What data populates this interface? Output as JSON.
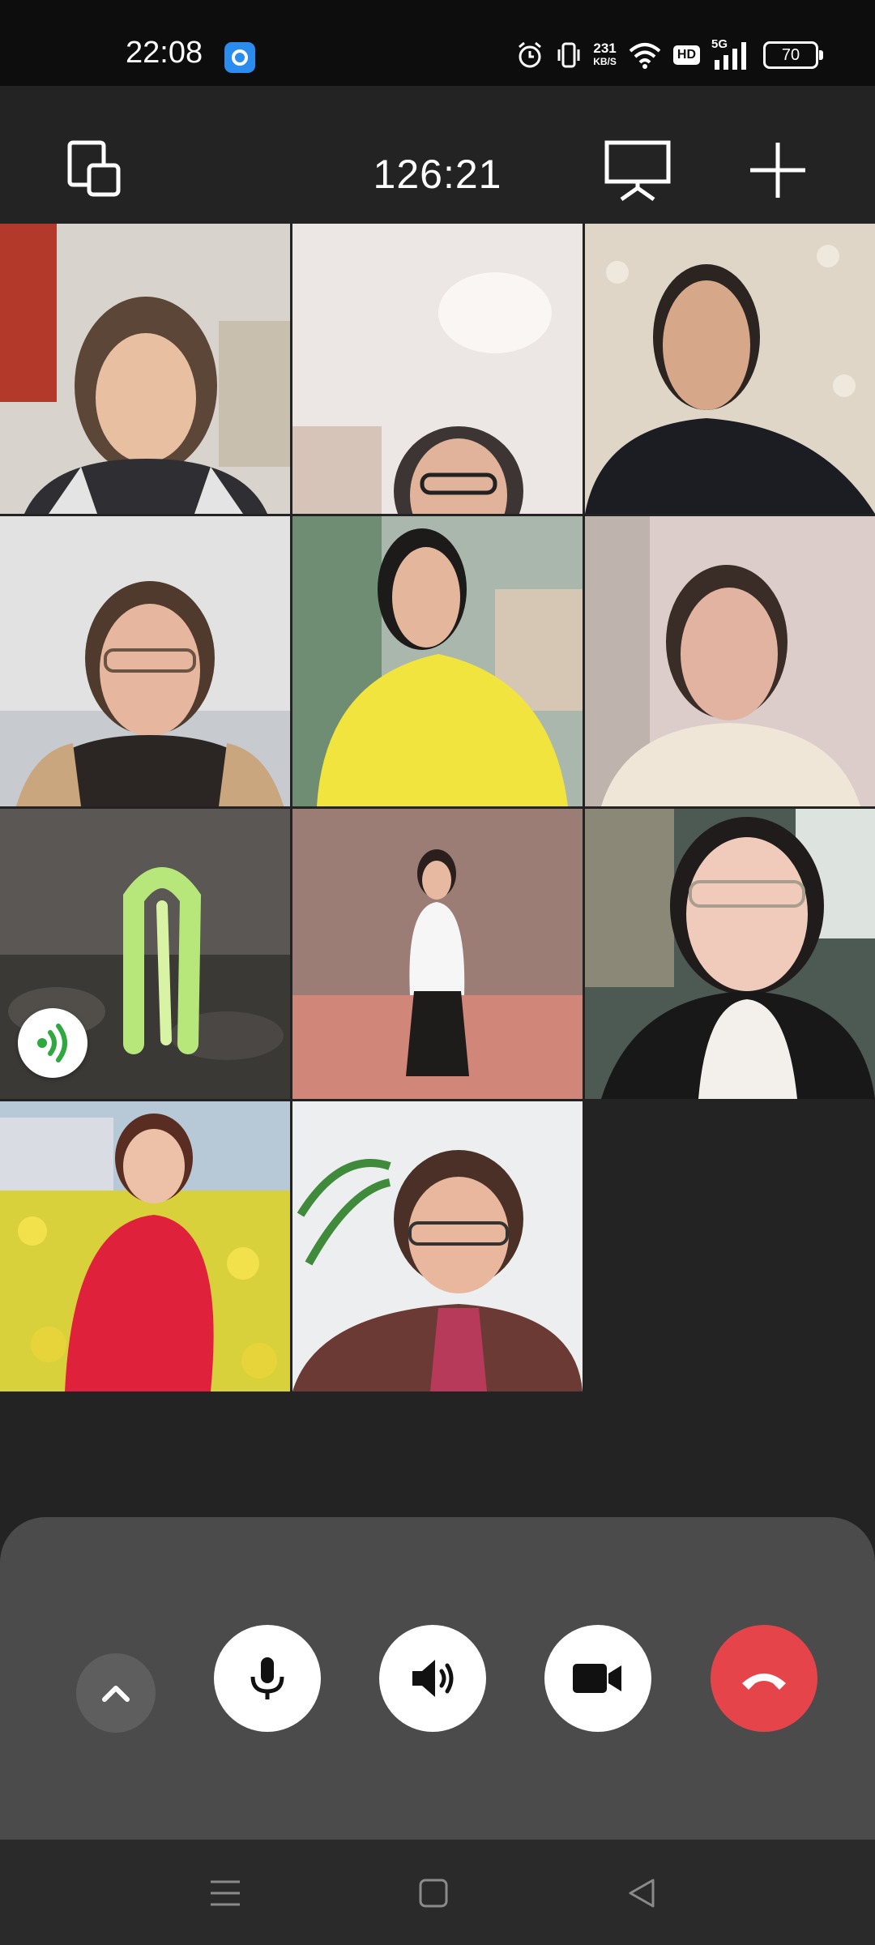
{
  "status_bar": {
    "time": "22:08",
    "app_badge_icon": "app-notification-icon",
    "net_speed_value": "231",
    "net_speed_unit": "KB/S",
    "hd_label": "HD",
    "network_label": "5G",
    "battery_level": "70"
  },
  "call": {
    "duration": "126:21",
    "left_button_icon": "minimize-window-icon",
    "screen_share_icon": "screen-share-icon",
    "add_icon": "add-participant-icon"
  },
  "participants": [
    {
      "name_icon": "participant-video-1",
      "bg": "#cfcac5"
    },
    {
      "name_icon": "participant-video-2",
      "bg": "#e7e2df"
    },
    {
      "name_icon": "participant-video-3",
      "bg": "#d6cdbf"
    },
    {
      "name_icon": "participant-video-4",
      "bg": "#dcdbdb"
    },
    {
      "name_icon": "participant-video-5",
      "bg": "#9aa59a"
    },
    {
      "name_icon": "participant-video-6",
      "bg": "#d8c9c7"
    },
    {
      "name_icon": "participant-avatar-sprout",
      "bg": "#4a4744",
      "speaking": true
    },
    {
      "name_icon": "participant-video-8",
      "bg": "#b08a7b"
    },
    {
      "name_icon": "participant-video-9",
      "bg": "#3f4741"
    },
    {
      "name_icon": "participant-avatar-flowers",
      "bg": "#c9cf3a"
    },
    {
      "name_icon": "participant-avatar-portrait",
      "bg": "#e4e6e8"
    }
  ],
  "controls": {
    "collapse_icon": "chevron-up-icon",
    "mic_icon": "microphone-icon",
    "speaker_icon": "speaker-icon",
    "camera_icon": "video-camera-icon",
    "hangup_icon": "hang-up-icon",
    "hangup_color": "#e5444a"
  },
  "system_nav": {
    "menu_icon": "menu-icon",
    "home_icon": "home-icon",
    "back_icon": "back-icon"
  },
  "colors": {
    "background": "#232323",
    "panel": "#4b4b4b",
    "speaking_green": "#2fa83f"
  }
}
